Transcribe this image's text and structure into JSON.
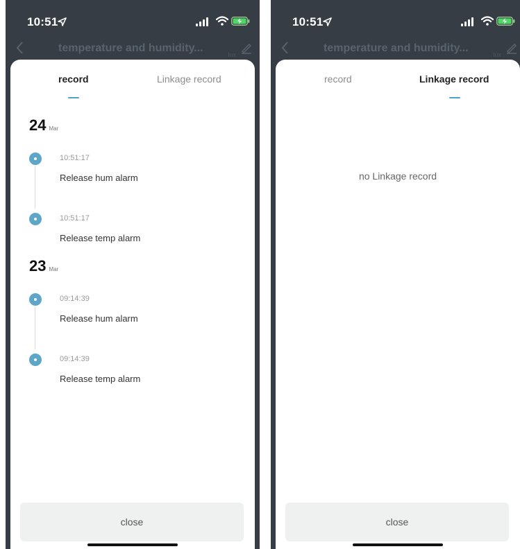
{
  "status_bar": {
    "time": "10:51"
  },
  "nav": {
    "title": "temperature and humidity...",
    "lux_label": "lux"
  },
  "tabs": [
    {
      "label": "record"
    },
    {
      "label": "Linkage record"
    }
  ],
  "left_panel": {
    "active_tab": "record",
    "groups": [
      {
        "day": "24",
        "month": "Mar",
        "events": [
          {
            "time": "10:51:17",
            "text": "Release hum alarm"
          },
          {
            "time": "10:51:17",
            "text": "Release temp alarm"
          }
        ]
      },
      {
        "day": "23",
        "month": "Mar",
        "events": [
          {
            "time": "09:14:39",
            "text": "Release hum alarm"
          },
          {
            "time": "09:14:39",
            "text": "Release temp alarm"
          }
        ]
      }
    ]
  },
  "right_panel": {
    "active_tab": "Linkage record",
    "empty_message": "no Linkage record"
  },
  "close_label": "close",
  "colors": {
    "accent": "#4ba3c9",
    "dot": "#5da6c9",
    "background_dim": "#363d44",
    "button_bg": "#eff0f0"
  }
}
